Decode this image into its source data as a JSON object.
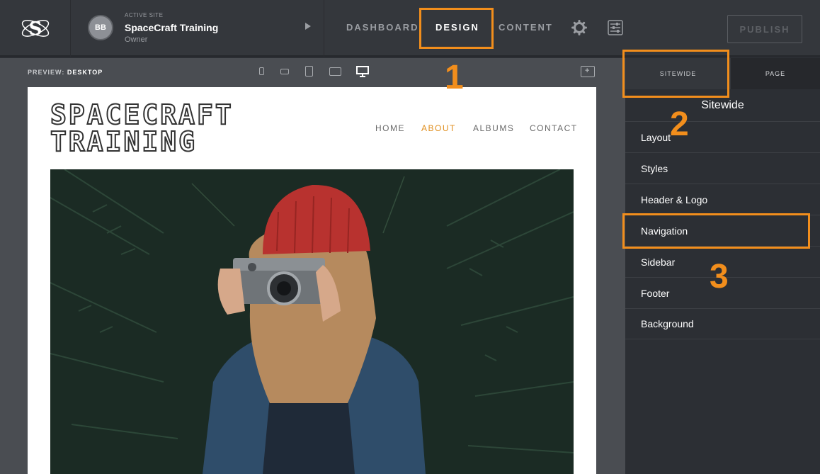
{
  "topbar": {
    "logo_icon": "spacecraft-logo-icon",
    "site": {
      "avatar_initials": "BB",
      "eyebrow": "ACTIVE SITE",
      "name": "SpaceCraft Training",
      "role": "Owner"
    },
    "tabs": [
      "DASHBOARD",
      "DESIGN",
      "CONTENT"
    ],
    "active_tab": "DESIGN",
    "publish_label": "PUBLISH"
  },
  "preview": {
    "label_prefix": "PREVIEW:",
    "label_value": "DESKTOP",
    "devices": [
      "phone-portrait-icon",
      "phone-landscape-icon",
      "tablet-portrait-icon",
      "tablet-landscape-icon",
      "desktop-icon"
    ],
    "active_device": "desktop-icon"
  },
  "site_preview": {
    "brand_line1": "SPACECRAFT",
    "brand_line2": "TRAINING",
    "menu": [
      "HOME",
      "ABOUT",
      "ALBUMS",
      "CONTACT"
    ],
    "active_menu": "ABOUT"
  },
  "panel": {
    "tabs": [
      "SITEWIDE",
      "PAGE"
    ],
    "title": "Sitewide",
    "items": [
      "Layout",
      "Styles",
      "Header & Logo",
      "Navigation",
      "Sidebar",
      "Footer",
      "Background"
    ]
  },
  "annotations": [
    "1",
    "2",
    "3"
  ],
  "colors": {
    "accent": "#f28e1c",
    "menu_active": "#e08e1d",
    "topbar_bg": "#34373c",
    "panel_bg": "#2c2f34"
  }
}
